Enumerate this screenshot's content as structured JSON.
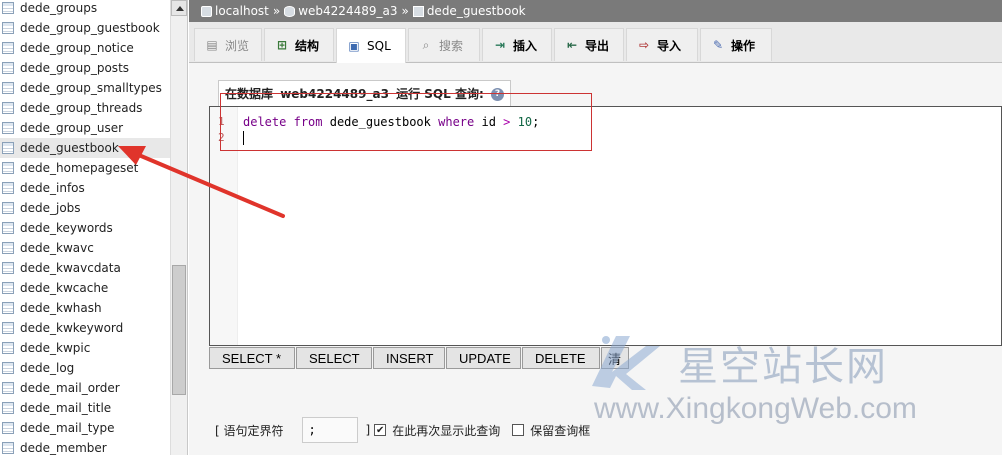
{
  "sidebar": {
    "tables": [
      "dede_groups",
      "dede_group_guestbook",
      "dede_group_notice",
      "dede_group_posts",
      "dede_group_smalltypes",
      "dede_group_threads",
      "dede_group_user",
      "dede_guestbook",
      "dede_homepageset",
      "dede_infos",
      "dede_jobs",
      "dede_keywords",
      "dede_kwavc",
      "dede_kwavcdata",
      "dede_kwcache",
      "dede_kwhash",
      "dede_kwkeyword",
      "dede_kwpic",
      "dede_log",
      "dede_mail_order",
      "dede_mail_title",
      "dede_mail_type",
      "dede_member"
    ],
    "selected": "dede_guestbook"
  },
  "breadcrumb": {
    "server": "localhost",
    "sep": "»",
    "database": "web4224489_a3",
    "table": "dede_guestbook"
  },
  "tabs": {
    "browse": "浏览",
    "structure": "结构",
    "sql": "SQL",
    "search": "搜索",
    "insert": "插入",
    "export": "导出",
    "import": "导入",
    "operations": "操作"
  },
  "query": {
    "legend_prefix": "在数据库",
    "legend_db": "web4224489_a3",
    "legend_suffix": "运行 SQL 查询:",
    "line_numbers": [
      "1",
      "2"
    ],
    "sql": {
      "kw_delete": "delete",
      "kw_from": "from",
      "table": "dede_guestbook",
      "kw_where": "where",
      "column": "id",
      "operator": ">",
      "value": "10",
      "terminator": ";"
    }
  },
  "buttons": [
    "SELECT *",
    "SELECT",
    "INSERT",
    "UPDATE",
    "DELETE",
    "清"
  ],
  "options": {
    "delimiter_label": "[ 语句定界符",
    "delimiter_value": ";",
    "delimiter_close": "]",
    "show_again_label": "在此再次显示此查询",
    "show_again_checked": "✔",
    "retain_box_label": "保留查询框"
  },
  "watermark": {
    "cn": "星空站长网",
    "en": "www.XingkongWeb.com"
  },
  "colors": {
    "annotation": "#e0342b",
    "topbar": "#7a7a7a"
  }
}
